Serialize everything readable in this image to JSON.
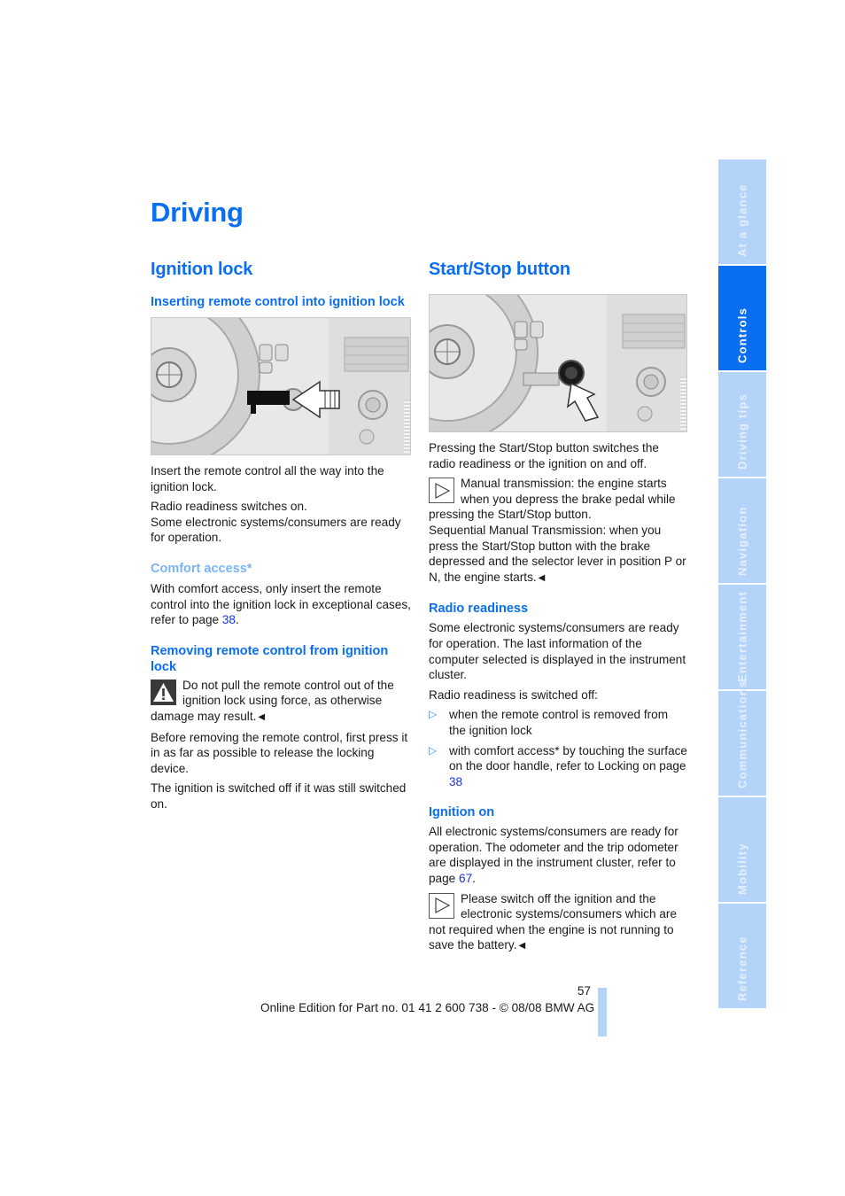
{
  "page": {
    "title": "Driving",
    "number": "57",
    "footer": "Online Edition for Part no. 01 41 2 600 738 - © 08/08 BMW AG"
  },
  "colors": {
    "accent": "#0a6ef0",
    "accent_light": "#7ab3f5",
    "tab_inactive": "#b3d4f8",
    "link": "#1a33dd"
  },
  "left": {
    "heading": "Ignition lock",
    "inserting": {
      "heading": "Inserting remote control into ignition lock",
      "figure_alt": "Remote control being inserted into ignition lock beside steering wheel",
      "p1": "Insert the remote control all the way into the ignition lock.",
      "p2a": "Radio readiness switches on.",
      "p2b": "Some electronic systems/consumers are ready for operation."
    },
    "comfort": {
      "heading": "Comfort access*",
      "text": "With comfort access, only insert the remote control into the ignition lock in exceptional cases, refer to page ",
      "page": "38",
      "after": "."
    },
    "removing": {
      "heading": "Removing remote control from ignition lock",
      "warning_icon": "warning-triangle-icon",
      "warning": "Do not pull the remote control out of the ignition lock using force, as otherwise damage may result.",
      "p1": "Before removing the remote control, first press it in as far as possible to release the locking device.",
      "p2": "The ignition is switched off if it was still switched on."
    }
  },
  "right": {
    "heading": "Start/Stop button",
    "figure_alt": "Start/Stop button next to steering wheel with arrow pointing at it",
    "intro": "Pressing the Start/Stop button switches the radio readiness or the ignition on and off.",
    "note1_icon": "note-triangle-icon",
    "note1a": "Manual transmission: the engine starts when you depress the brake pedal while pressing the Start/Stop button.",
    "note1b": "Sequential Manual Transmission: when you press the Start/Stop button with the brake depressed and the selector lever in position P or N, the engine starts.",
    "radio": {
      "heading": "Radio readiness",
      "p1": "Some electronic systems/consumers are ready for operation. The last information of the computer selected is displayed in the instrument cluster.",
      "p2": "Radio readiness is switched off:",
      "bullets": [
        {
          "text": "when the remote control is removed from the ignition lock"
        },
        {
          "text": "with comfort access* by touching the surface on the door handle, refer to Locking on page ",
          "page": "38"
        }
      ]
    },
    "ignition": {
      "heading": "Ignition on",
      "p1": "All electronic systems/consumers are ready for operation. The odometer and the trip odometer are displayed in the instrument cluster, refer to page ",
      "page": "67",
      "after": ".",
      "note_icon": "note-triangle-icon",
      "note": "Please switch off the ignition and the electronic systems/consumers which are not required when the engine is not running to save the battery."
    }
  },
  "tabs": [
    {
      "label": "At a glance",
      "active": false
    },
    {
      "label": "Controls",
      "active": true
    },
    {
      "label": "Driving tips",
      "active": false
    },
    {
      "label": "Navigation",
      "active": false
    },
    {
      "label": "Entertainment",
      "active": false
    },
    {
      "label": "Communications",
      "active": false
    },
    {
      "label": "Mobility",
      "active": false
    },
    {
      "label": "Reference",
      "active": false
    }
  ]
}
